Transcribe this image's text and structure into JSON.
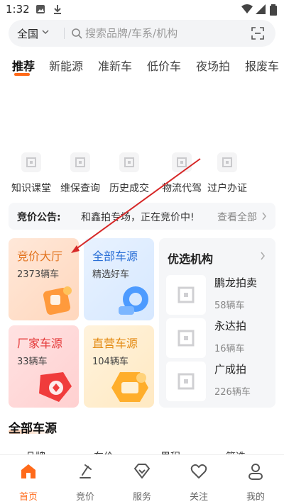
{
  "status_bar": {
    "time": "1:32"
  },
  "search": {
    "city": "全国",
    "placeholder": "搜索品牌/车系/机构"
  },
  "tabs": [
    {
      "label": "推荐",
      "active": true
    },
    {
      "label": "新能源"
    },
    {
      "label": "准新车"
    },
    {
      "label": "低价车"
    },
    {
      "label": "夜场拍"
    },
    {
      "label": "报废车"
    }
  ],
  "shortcuts": [
    {
      "label": "知识课堂",
      "icon": "knowledge-icon"
    },
    {
      "label": "维保查询",
      "icon": "maintenance-icon"
    },
    {
      "label": "历史成交",
      "icon": "history-icon"
    },
    {
      "label": "物流代驾",
      "icon": "logistics-icon"
    },
    {
      "label": "过户办证",
      "icon": "transfer-icon"
    }
  ],
  "notice": {
    "title": "竞价公告:",
    "text": "和鑫拍专场，正在竞价中!",
    "more": "查看全部"
  },
  "cards": [
    {
      "title": "竞价大厅",
      "sub": "2373辆车"
    },
    {
      "title": "全部车源",
      "sub": "精选好车"
    },
    {
      "title": "厂家车源",
      "sub": "33辆车"
    },
    {
      "title": "直营车源",
      "sub": "104辆车"
    }
  ],
  "preferred": {
    "title": "优选机构",
    "orgs": [
      {
        "name": "鹏龙拍卖",
        "count": "58辆车"
      },
      {
        "name": "永达拍",
        "count": "16辆车"
      },
      {
        "name": "广成拍",
        "count": "226辆车"
      }
    ]
  },
  "all_cars": {
    "title": "全部车源",
    "filters": [
      "品牌",
      "车价",
      "里程",
      "筛选"
    ]
  },
  "bottom_nav": [
    {
      "label": "首页",
      "active": true,
      "icon": "home-icon"
    },
    {
      "label": "竞价",
      "icon": "auction-icon"
    },
    {
      "label": "服务",
      "icon": "service-icon"
    },
    {
      "label": "关注",
      "icon": "heart-icon"
    },
    {
      "label": "我的",
      "icon": "profile-icon"
    }
  ],
  "colors": {
    "accent": "#ff6a1a",
    "annotation_arrow": "#d62828"
  }
}
